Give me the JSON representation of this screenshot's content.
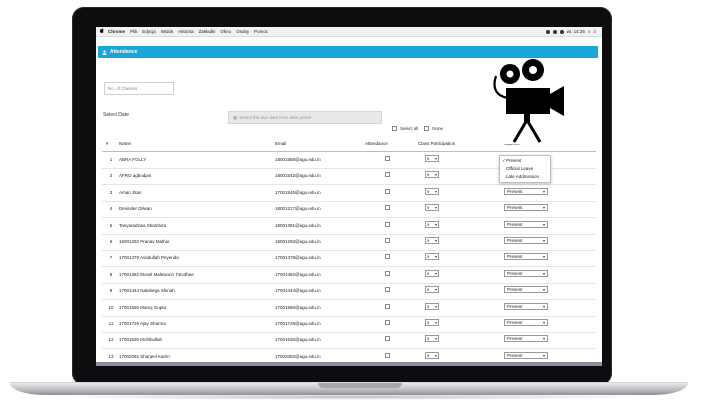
{
  "menubar": {
    "apple": "",
    "items": [
      "Chrome",
      "Plik",
      "Edycja",
      "Widok",
      "Historia",
      "Zakładki",
      "Okno",
      "Osoby",
      "Pomoc"
    ],
    "clock": "wt. 14:26"
  },
  "app": {
    "title": "Attendance",
    "classes_placeholder": "No. of Classes",
    "select_date_label": "Select Date",
    "date_placeholder": "Select the due date from date picker",
    "select_all_label": "Select all",
    "none_label": "None"
  },
  "table": {
    "headers": {
      "num": "#",
      "name": "Name",
      "email": "Email",
      "attendance": "Attendance",
      "participation": "Class Participation",
      "status": "Options"
    },
    "rows": [
      {
        "num": "1",
        "name": "ABRA FOLLY",
        "email": "18001558@agu.edu.in",
        "cp": "5",
        "status": ""
      },
      {
        "num": "2",
        "name": "AFRO agbodjan",
        "email": "18001542@agu.edu.in",
        "cp": "5",
        "status": ""
      },
      {
        "num": "3",
        "name": "Aman Jitan",
        "email": "17001545@agu.edu.in",
        "cp": "5",
        "status": "Present"
      },
      {
        "num": "4",
        "name": "Devinder Dilwan",
        "email": "18001217@agu.edu.in",
        "cp": "5",
        "status": "Present"
      },
      {
        "num": "5",
        "name": "Tanyaradzwa Shambira",
        "email": "18001381@agu.edu.in",
        "cp": "5",
        "status": "Present"
      },
      {
        "num": "6",
        "name": "16001292 Pranav Mathur",
        "email": "16001292@agu.edu.in",
        "cp": "5",
        "status": "Present"
      },
      {
        "num": "7",
        "name": "17001378 Asadullah Peyenda",
        "email": "17001378@agu.edu.in",
        "cp": "5",
        "status": "Present"
      },
      {
        "num": "8",
        "name": "17001362 Mosel Malewono Timothee",
        "email": "17001362@agu.edu.in",
        "cp": "5",
        "status": "Present"
      },
      {
        "num": "9",
        "name": "17001444 Nalubega Shinah",
        "email": "17001444@agu.edu.in",
        "cp": "5",
        "status": "Present"
      },
      {
        "num": "10",
        "name": "17001560 Manoj Gupta",
        "email": "17001560@agu.edu.in",
        "cp": "5",
        "status": "Present"
      },
      {
        "num": "11",
        "name": "17001729 Ajay Sharma",
        "email": "17001729@agu.edu.in",
        "cp": "5",
        "status": "Present"
      },
      {
        "num": "12",
        "name": "17001630 Mohibullah",
        "email": "17001630@agu.edu.in",
        "cp": "5",
        "status": "Present"
      },
      {
        "num": "13",
        "name": "17002092 Sharjeel Karim",
        "email": "17002092@agu.edu.in",
        "cp": "5",
        "status": "Present"
      }
    ]
  },
  "dropdown": {
    "check": "✓",
    "options": [
      "Present",
      "Official Leave",
      "Late Addmission"
    ]
  },
  "icons": {
    "camera": "movie-camera-icon"
  },
  "colors": {
    "accent": "#1aa6d8"
  }
}
